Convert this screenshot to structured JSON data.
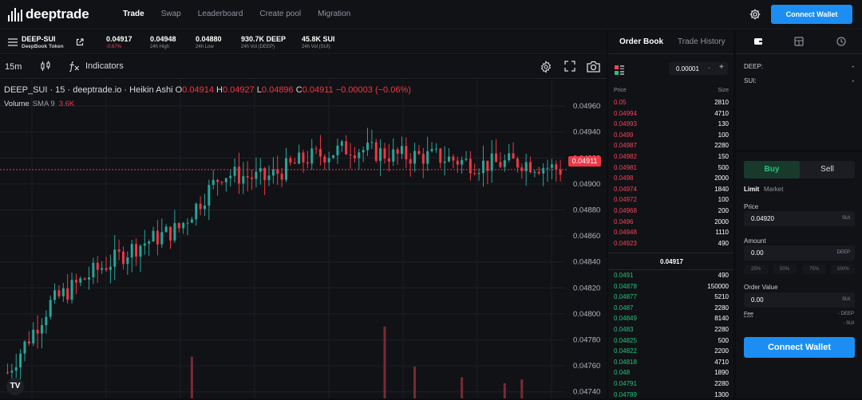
{
  "app": {
    "name": "deeptrade"
  },
  "nav": {
    "items": [
      "Trade",
      "Swap",
      "Leaderboard",
      "Create pool",
      "Migration"
    ],
    "active": "Trade"
  },
  "header": {
    "connect_label": "Connect Wallet"
  },
  "market": {
    "pair": "DEEP-SUI",
    "token_name": "DeepBook Token",
    "price": "0.04917",
    "change": "-0.67%",
    "high_value": "0.04948",
    "high_label": "24h High",
    "low_value": "0.04880",
    "low_label": "24h Low",
    "vol_deep_value": "930.7K DEEP",
    "vol_deep_label": "24h Vol (DEEP)",
    "vol_sui_value": "45.8K SUI",
    "vol_sui_label": "24h Vol (SUI)"
  },
  "chart_toolbar": {
    "timeframe": "15m",
    "indicators_label": "Indicators"
  },
  "chart_legend": {
    "title": "DEEP_SUI · 15 · deeptrade.io · Heikin Ashi",
    "o_label": "O",
    "o_value": "0.04914",
    "h_label": "H",
    "h_value": "0.04927",
    "l_label": "L",
    "l_value": "0.04896",
    "c_label": "C",
    "c_value": "0.04911",
    "change": "−0.00003 (−0.06%)",
    "volume_label": "Volume",
    "sma_label": "SMA 9",
    "volume_value": "3.6K"
  },
  "chart_data": {
    "type": "candlestick",
    "title": "DEEP_SUI · 15 · deeptrade.io · Heikin Ashi",
    "y_ticks": [
      "0.04960",
      "0.04940",
      "0.04920",
      "0.04900",
      "0.04880",
      "0.04860",
      "0.04840",
      "0.04820",
      "0.04800",
      "0.04780",
      "0.04760",
      "0.04740"
    ],
    "ylim": [
      0.04738,
      0.04968
    ],
    "last_price": "0.04911",
    "grid": true,
    "seed": 7,
    "count": 130,
    "path_anchors": [
      [
        0,
        0.04755
      ],
      [
        10,
        0.04808
      ],
      [
        20,
        0.04832
      ],
      [
        30,
        0.04852
      ],
      [
        40,
        0.04866
      ],
      [
        50,
        0.04908
      ],
      [
        60,
        0.04904
      ],
      [
        70,
        0.0492
      ],
      [
        80,
        0.04928
      ],
      [
        90,
        0.04922
      ],
      [
        100,
        0.04921
      ],
      [
        110,
        0.04915
      ],
      [
        120,
        0.04917
      ],
      [
        129,
        0.04911
      ]
    ],
    "volume_bars": [
      {
        "i": 43,
        "v": 0.55
      },
      {
        "i": 88,
        "v": 0.95
      },
      {
        "i": 95,
        "v": 0.42
      },
      {
        "i": 106,
        "v": 0.28
      },
      {
        "i": 116,
        "v": 0.2
      },
      {
        "i": 120,
        "v": 0.25
      }
    ]
  },
  "order_book": {
    "tabs": [
      "Order Book",
      "Trade History"
    ],
    "step": "0.00001",
    "price_header": "Price",
    "size_header": "Size",
    "asks": [
      [
        "0.05",
        "2810"
      ],
      [
        "0.04994",
        "4710"
      ],
      [
        "0.04993",
        "130"
      ],
      [
        "0.0499",
        "100"
      ],
      [
        "0.04987",
        "2280"
      ],
      [
        "0.04982",
        "150"
      ],
      [
        "0.04981",
        "500"
      ],
      [
        "0.0498",
        "2000"
      ],
      [
        "0.04974",
        "1840"
      ],
      [
        "0.04972",
        "100"
      ],
      [
        "0.04968",
        "200"
      ],
      [
        "0.0496",
        "2000"
      ],
      [
        "0.04948",
        "1110"
      ],
      [
        "0.04923",
        "490"
      ]
    ],
    "mid": "0.04917",
    "bids": [
      [
        "0.0491",
        "490"
      ],
      [
        "0.04878",
        "150000"
      ],
      [
        "0.04877",
        "5210"
      ],
      [
        "0.0487",
        "2280"
      ],
      [
        "0.04849",
        "8140"
      ],
      [
        "0.0483",
        "2280"
      ],
      [
        "0.04825",
        "500"
      ],
      [
        "0.04822",
        "2200"
      ],
      [
        "0.04818",
        "4710"
      ],
      [
        "0.048",
        "1890"
      ],
      [
        "0.04791",
        "2280"
      ],
      [
        "0.04789",
        "1300"
      ]
    ]
  },
  "balances": {
    "deep_label": "DEEP:",
    "deep_value": "-",
    "sui_label": "SUI:",
    "sui_value": "-"
  },
  "trade_form": {
    "buy_label": "Buy",
    "sell_label": "Sell",
    "limit_label": "Limit",
    "market_label": "Market",
    "price_label": "Price",
    "price_value": "0.04920",
    "price_unit": "SUI",
    "amount_label": "Amount",
    "amount_value": "0.00",
    "amount_unit": "DEEP",
    "percents": [
      "25%",
      "50%",
      "75%",
      "100%"
    ],
    "order_value_label": "Order Value",
    "order_value": "0.00",
    "order_value_unit": "SUI",
    "fee_label": "Fee",
    "fee_deep": "- DEEP",
    "fee_sui": "- SUI",
    "connect_label": "Connect Wallet"
  },
  "colors": {
    "up": "#26a69a",
    "down": "#f23645",
    "accent": "#1c8ef3",
    "bid": "#27c17d",
    "ask": "#f0455a"
  }
}
